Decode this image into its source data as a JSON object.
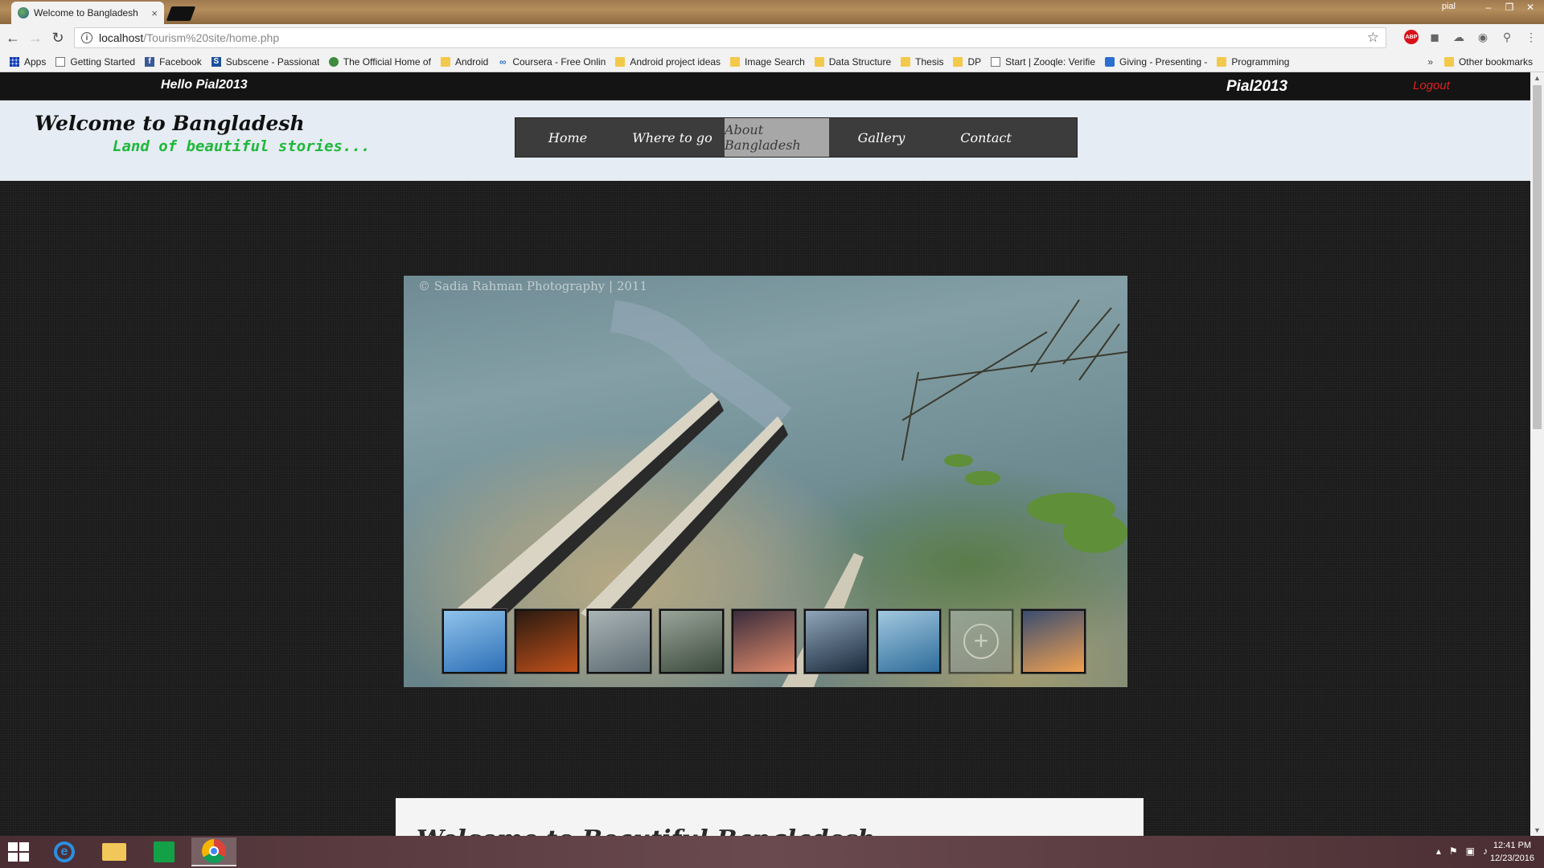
{
  "browser": {
    "tab_title": "Welcome to Bangladesh",
    "tab_close": "×",
    "window_user": "pial",
    "url_host": "localhost",
    "url_path": "/Tourism%20site/home.php",
    "bookmarks": [
      {
        "label": "Apps",
        "icon": "apps-icon"
      },
      {
        "label": "Getting Started",
        "icon": "page-icon"
      },
      {
        "label": "Facebook",
        "icon": "facebook-icon"
      },
      {
        "label": "Subscene - Passionat",
        "icon": "subscene-icon"
      },
      {
        "label": "The Official Home of",
        "icon": "leaf-icon"
      },
      {
        "label": "Android",
        "icon": "folder-icon"
      },
      {
        "label": "Coursera - Free Onlin",
        "icon": "coursera-icon"
      },
      {
        "label": "Android project ideas",
        "icon": "folder-icon"
      },
      {
        "label": "Image Search",
        "icon": "folder-icon"
      },
      {
        "label": "Data Structure",
        "icon": "folder-icon"
      },
      {
        "label": "Thesis",
        "icon": "folder-icon"
      },
      {
        "label": "DP",
        "icon": "folder-icon"
      },
      {
        "label": "Start | Zooqle: Verifie",
        "icon": "page-icon"
      },
      {
        "label": "Giving - Presenting -",
        "icon": "shield-icon"
      },
      {
        "label": "Programming",
        "icon": "folder-icon"
      }
    ],
    "bookmarks_more": "»",
    "other_bookmarks": "Other bookmarks"
  },
  "site": {
    "greeting": "Hello  Pial2013",
    "username": "Pial2013",
    "logout": "Logout",
    "title": "Welcome to Bangladesh",
    "tagline": "Land of beautiful stories...",
    "menu": [
      {
        "label": "Home",
        "active": false
      },
      {
        "label": "Where to go",
        "active": false
      },
      {
        "label": "About Bangladesh",
        "active": true
      },
      {
        "label": "Gallery",
        "active": false
      },
      {
        "label": "Contact",
        "active": false
      }
    ],
    "slider_watermark": "© Sadia Rahman Photography | 2011",
    "thumbnails": [
      {
        "colors": [
          "#2d6fb7",
          "#8fc3ea"
        ]
      },
      {
        "colors": [
          "#c0501a",
          "#2a1a10"
        ]
      },
      {
        "colors": [
          "#5d6b73",
          "#a9b4b5"
        ]
      },
      {
        "colors": [
          "#3b4a3c",
          "#9aa59a"
        ]
      },
      {
        "colors": [
          "#e08a6a",
          "#3a2c3c"
        ]
      },
      {
        "colors": [
          "#1b2a3e",
          "#8fa6b8"
        ]
      },
      {
        "colors": [
          "#2d6c9a",
          "#a2c8df"
        ]
      },
      {
        "colors": [
          "#7f8b8c",
          "#b4bcbc"
        ]
      },
      {
        "colors": [
          "#f0a050",
          "#3a4d70"
        ]
      }
    ],
    "content_heading": "Welcome to Beautiful Bangladesh"
  },
  "taskbar": {
    "time": "12:41 PM",
    "date": "12/23/2016"
  }
}
